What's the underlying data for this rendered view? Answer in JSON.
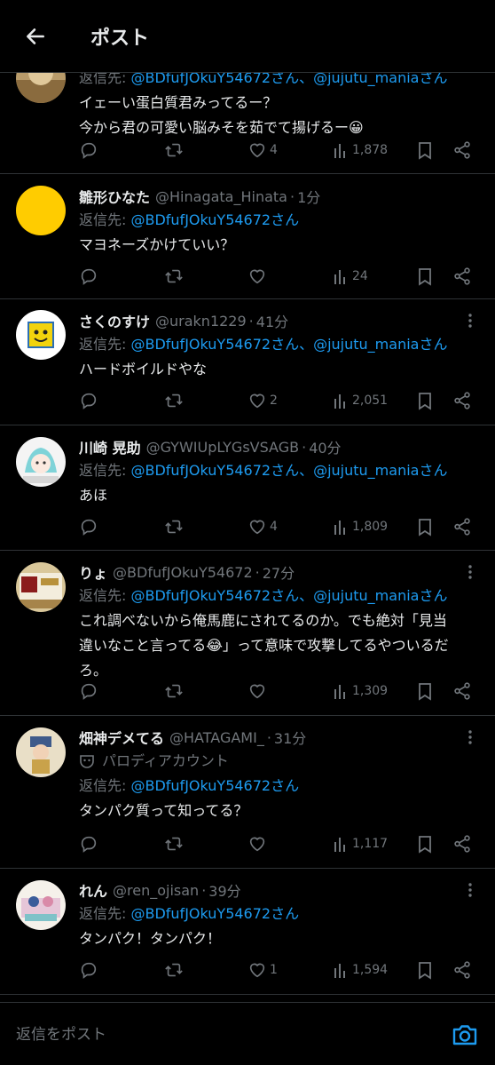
{
  "header": {
    "title": "ポスト",
    "back_icon": "arrow-left-icon"
  },
  "posts": [
    {
      "name": "",
      "handle": "",
      "time": "",
      "reply_prefix": "返信先: ",
      "reply_to": "@BDfufJOkuY54672さん、@jujutu_maniaさん",
      "text_lines": [
        "イェーい蛋白質君みってるー？",
        "今から君の可愛い脳みそを茹でて揚げるー😀"
      ],
      "replies": "",
      "retweets": "",
      "likes": "4",
      "views": "1,878",
      "avatar": "cropped-photo"
    },
    {
      "name": "雛形ひなた",
      "handle": "@Hinagata_Hinata",
      "time": "1分",
      "reply_prefix": "返信先: ",
      "reply_to": "@BDfufJOkuY54672さん",
      "text_lines": [
        "マヨネーズかけていい？"
      ],
      "replies": "",
      "retweets": "",
      "likes": "",
      "views": "24",
      "avatar": "yellow-circle"
    },
    {
      "name": "さくのすけ",
      "handle": "@urakn1229",
      "time": "41分",
      "reply_prefix": "返信先: ",
      "reply_to": "@BDfufJOkuY54672さん、@jujutu_maniaさん",
      "text_lines": [
        "ハードボイルドやな"
      ],
      "replies": "",
      "retweets": "",
      "likes": "2",
      "views": "2,051",
      "avatar": "yellow-face"
    },
    {
      "name": "川崎 晃助",
      "handle": "@GYWIUpLYGsVSAGB",
      "time": "40分",
      "reply_prefix": "返信先: ",
      "reply_to": "@BDfufJOkuY54672さん、@jujutu_maniaさん",
      "text_lines": [
        "あほ"
      ],
      "replies": "",
      "retweets": "",
      "likes": "4",
      "views": "1,809",
      "avatar": "anime-drawing"
    },
    {
      "name": "りょ",
      "handle": "@BDfufJOkuY54672",
      "time": "27分",
      "reply_prefix": "返信先: ",
      "reply_to": "@BDfufJOkuY54672さん、@jujutu_maniaさん",
      "text_lines": [
        "これ調べないから俺馬鹿にされてるのか。でも絶対「見当",
        "違いなこと言ってる😂」って意味で攻撃してるやついるだ",
        "ろ。"
      ],
      "replies": "",
      "retweets": "",
      "likes": "",
      "views": "1,309",
      "avatar": "food-package"
    },
    {
      "name": "畑神デメてる",
      "handle": "@HATAGAMI_",
      "time": "31分",
      "parody_label": "パロディアカウント",
      "reply_prefix": "返信先: ",
      "reply_to": "@BDfufJOkuY54672さん",
      "text_lines": [
        "タンパク質って知ってる？"
      ],
      "replies": "",
      "retweets": "",
      "likes": "",
      "views": "1,117",
      "avatar": "character-photo"
    },
    {
      "name": "れん",
      "handle": "@ren_ojisan",
      "time": "39分",
      "reply_prefix": "返信先: ",
      "reply_to": "@BDfufJOkuY54672さん",
      "text_lines": [
        "タンパク！タンパク！"
      ],
      "replies": "",
      "retweets": "",
      "likes": "1",
      "views": "1,594",
      "avatar": "illustration"
    }
  ],
  "composer": {
    "placeholder": "返信をポスト",
    "camera_icon": "camera-icon"
  },
  "colors": {
    "background": "#000000",
    "text": "#e7e9ea",
    "muted": "#71767b",
    "link": "#1d9bf0",
    "divider": "#2f3336"
  }
}
